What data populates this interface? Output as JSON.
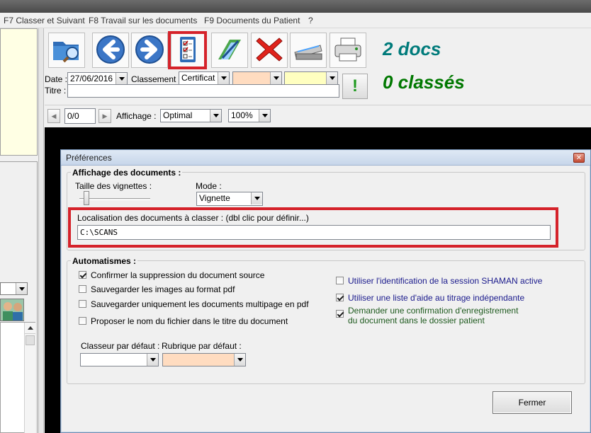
{
  "menu": {
    "items": [
      "F7 Classer et Suivant",
      "F8 Travail sur les documents",
      "F9 Documents du Patient",
      "?"
    ]
  },
  "toolbar": {
    "icons": [
      "folder-search-icon",
      "back-arrow-icon",
      "forward-arrow-icon",
      "checklist-icon",
      "pen-edit-icon",
      "delete-x-icon",
      "scanner-icon",
      "printer-icon"
    ],
    "selected_index": 3
  },
  "form": {
    "date_label": "Date :",
    "date_value": "27/06/2016",
    "classement_label": "Classement :",
    "classement_value": "Certificat",
    "combo_peach_value": "",
    "combo_yellow_value": "",
    "titre_label": "Titre :",
    "titre_value": "",
    "excl_label": "!"
  },
  "counters": {
    "docs": "2 docs",
    "classes": "0 classés"
  },
  "navbar": {
    "page": "0/0",
    "affichage_label": "Affichage :",
    "affichage_value": "Optimal",
    "zoom_value": "100%"
  },
  "dialog": {
    "title": "Préférences",
    "group1_title": "Affichage des documents :",
    "taille_label": "Taille des vignettes :",
    "mode_label": "Mode :",
    "mode_value": "Vignette",
    "localisation_label": "Localisation des documents à classer : (dbl clic pour définir...)",
    "localisation_value": "C:\\SCANS",
    "group2_title": "Automatismes :",
    "checks_left": [
      {
        "label": "Confirmer la suppression du document source",
        "checked": true
      },
      {
        "label": "Sauvegarder les images au format pdf",
        "checked": false
      },
      {
        "label": "Sauvegarder uniquement les documents multipage en pdf",
        "checked": false
      },
      {
        "label": "Proposer le nom du fichier dans le titre du document",
        "checked": false
      }
    ],
    "checks_right": [
      {
        "label": "Utiliser l'identification de la session SHAMAN  active",
        "checked": false
      },
      {
        "label": "Utiliser une liste d'aide au titrage indépendante",
        "checked": true
      },
      {
        "label": "Demander une confirmation d'enregistrement du document dans le dossier patient",
        "checked": true
      }
    ],
    "classeur_label": "Classeur par défaut :",
    "classeur_value": "",
    "rubrique_label": "Rubrique par défaut :",
    "rubrique_value": "",
    "close_button": "Fermer"
  },
  "colors": {
    "docs_color": "#007b7b",
    "classes_color": "#007800",
    "highlight_red": "#d5222a",
    "peach": "#ffdcc0",
    "pale_yellow": "#ffffc0"
  }
}
